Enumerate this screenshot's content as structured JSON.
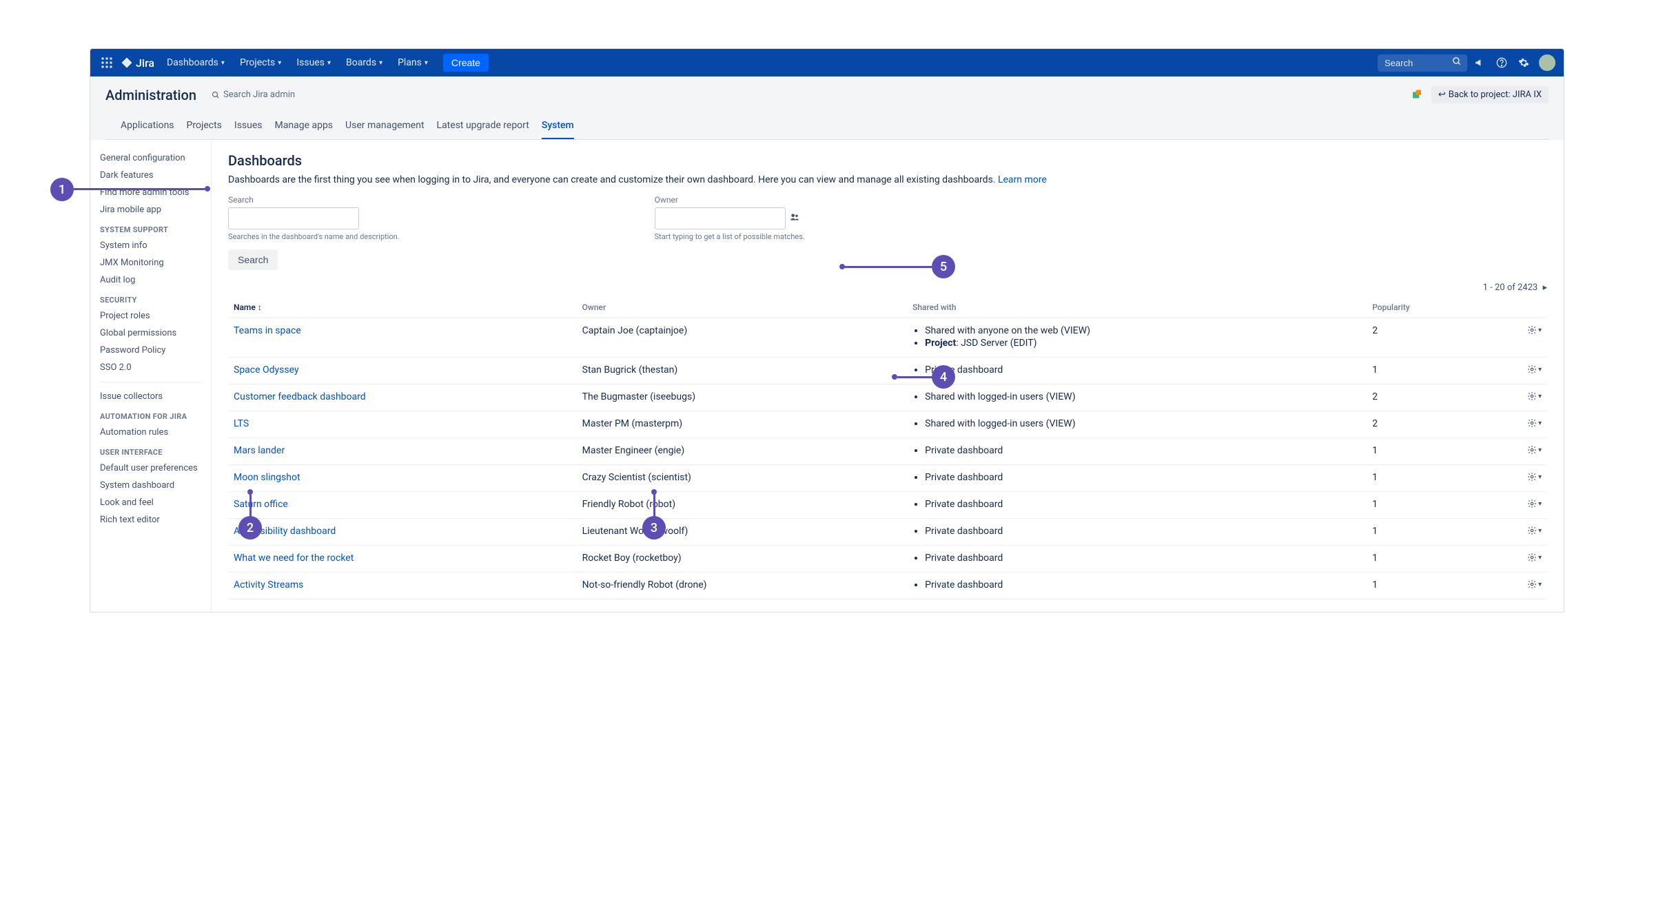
{
  "topnav": {
    "logo": "Jira",
    "items": [
      "Dashboards",
      "Projects",
      "Issues",
      "Boards",
      "Plans"
    ],
    "create": "Create",
    "search_placeholder": "Search"
  },
  "adminhead": {
    "title": "Administration",
    "search_placeholder": "Search Jira admin",
    "back": "Back to project: JIRA IX"
  },
  "tabs": [
    "Applications",
    "Projects",
    "Issues",
    "Manage apps",
    "User management",
    "Latest upgrade report",
    "System"
  ],
  "active_tab": "System",
  "sidebar": [
    {
      "type": "item",
      "label": "General configuration"
    },
    {
      "type": "item",
      "label": "Dark features"
    },
    {
      "type": "item",
      "label": "Find more admin tools"
    },
    {
      "type": "item",
      "label": "Jira mobile app"
    },
    {
      "type": "heading",
      "label": "SYSTEM SUPPORT"
    },
    {
      "type": "item",
      "label": "System info"
    },
    {
      "type": "item",
      "label": "JMX Monitoring"
    },
    {
      "type": "item",
      "label": "Audit log"
    },
    {
      "type": "heading",
      "label": "SECURITY"
    },
    {
      "type": "item",
      "label": "Project roles"
    },
    {
      "type": "item",
      "label": "Global permissions"
    },
    {
      "type": "item",
      "label": "Password Policy"
    },
    {
      "type": "item",
      "label": "SSO 2.0"
    },
    {
      "type": "divider"
    },
    {
      "type": "item",
      "label": "Issue collectors"
    },
    {
      "type": "heading",
      "label": "AUTOMATION FOR JIRA"
    },
    {
      "type": "item",
      "label": "Automation rules"
    },
    {
      "type": "heading",
      "label": "USER INTERFACE"
    },
    {
      "type": "item",
      "label": "Default user preferences"
    },
    {
      "type": "item",
      "label": "System dashboard"
    },
    {
      "type": "item",
      "label": "Look and feel"
    },
    {
      "type": "item",
      "label": "Rich text editor"
    }
  ],
  "page": {
    "title": "Dashboards",
    "description": "Dashboards are the first thing you see when logging in to Jira, and everyone can create and customize their own dashboard. Here you can view and manage all existing dashboards. ",
    "learn_more": "Learn more",
    "search_label": "Search",
    "search_hint": "Searches in the dashboard's name and description.",
    "owner_label": "Owner",
    "owner_hint": "Start typing to get a list of possible matches.",
    "search_button": "Search",
    "pager": "1 - 20 of 2423",
    "columns": {
      "name": "Name",
      "owner": "Owner",
      "shared": "Shared with",
      "popularity": "Popularity"
    }
  },
  "dashboards": [
    {
      "name": "Teams in space",
      "owner": "Captain Joe (captainjoe)",
      "shared": [
        "Shared with anyone on the web (VIEW)",
        "<b>Project</b>: JSD Server (EDIT)"
      ],
      "popularity": "2"
    },
    {
      "name": "Space Odyssey",
      "owner": "Stan Bugrick (thestan)",
      "shared": [
        "Private dashboard"
      ],
      "popularity": "1"
    },
    {
      "name": "Customer feedback dashboard",
      "owner": "The Bugmaster (iseebugs)",
      "shared": [
        "Shared with logged-in users (VIEW)"
      ],
      "popularity": "2"
    },
    {
      "name": "LTS",
      "owner": "Master PM (masterpm)",
      "shared": [
        "Shared with logged-in users (VIEW)"
      ],
      "popularity": "2"
    },
    {
      "name": "Mars lander",
      "owner": "Master Engineer (engie)",
      "shared": [
        "Private dashboard"
      ],
      "popularity": "1"
    },
    {
      "name": "Moon slingshot",
      "owner": "Crazy Scientist (scientist)",
      "shared": [
        "Private dashboard"
      ],
      "popularity": "1"
    },
    {
      "name": "Saturn office",
      "owner": "Friendly Robot (robot)",
      "shared": [
        "Private dashboard"
      ],
      "popularity": "1"
    },
    {
      "name": "Accessibility dashboard",
      "owner": "Lieutenant Woolf (woolf)",
      "shared": [
        "Private dashboard"
      ],
      "popularity": "1"
    },
    {
      "name": "What we need for the rocket",
      "owner": "Rocket Boy (rocketboy)",
      "shared": [
        "Private dashboard"
      ],
      "popularity": "1"
    },
    {
      "name": "Activity Streams",
      "owner": "Not-so-friendly Robot (drone)",
      "shared": [
        "Private dashboard"
      ],
      "popularity": "1"
    }
  ],
  "callouts": [
    "1",
    "2",
    "3",
    "4",
    "5"
  ]
}
